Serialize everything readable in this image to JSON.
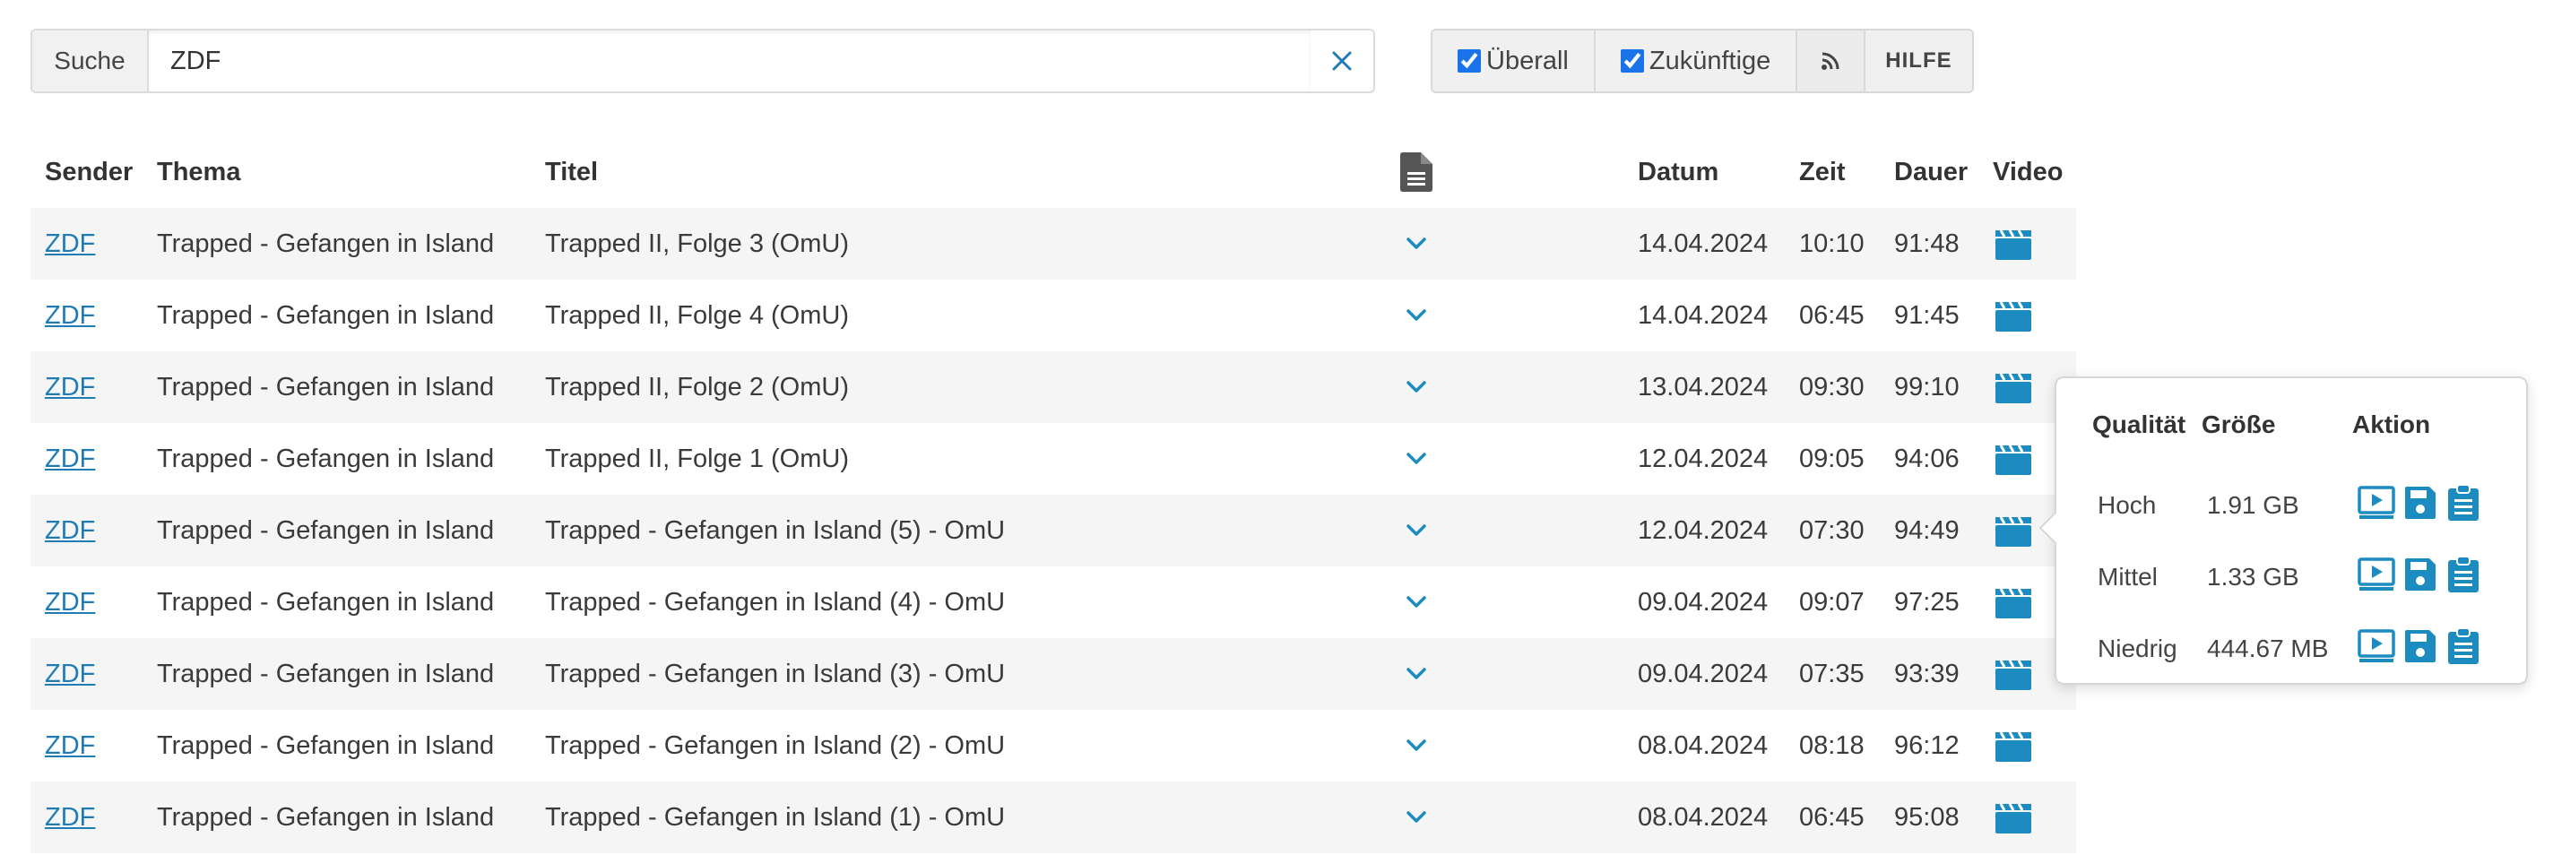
{
  "search": {
    "label": "Suche",
    "value": "ZDF"
  },
  "toolbar": {
    "everywhere_label": "Überall",
    "everywhere_checked": true,
    "future_label": "Zukünftige",
    "future_checked": true,
    "help_label": "HILFE"
  },
  "table": {
    "headers": {
      "sender": "Sender",
      "thema": "Thema",
      "titel": "Titel",
      "datum": "Datum",
      "zeit": "Zeit",
      "dauer": "Dauer",
      "video": "Video"
    },
    "rows": [
      {
        "sender": "ZDF",
        "thema": "Trapped - Gefangen in Island",
        "titel": "Trapped II, Folge 3 (OmU)",
        "datum": "14.04.2024",
        "zeit": "10:10",
        "dauer": "91:48"
      },
      {
        "sender": "ZDF",
        "thema": "Trapped - Gefangen in Island",
        "titel": "Trapped II, Folge 4 (OmU)",
        "datum": "14.04.2024",
        "zeit": "06:45",
        "dauer": "91:45"
      },
      {
        "sender": "ZDF",
        "thema": "Trapped - Gefangen in Island",
        "titel": "Trapped II, Folge 2 (OmU)",
        "datum": "13.04.2024",
        "zeit": "09:30",
        "dauer": "99:10"
      },
      {
        "sender": "ZDF",
        "thema": "Trapped - Gefangen in Island",
        "titel": "Trapped II, Folge 1 (OmU)",
        "datum": "12.04.2024",
        "zeit": "09:05",
        "dauer": "94:06"
      },
      {
        "sender": "ZDF",
        "thema": "Trapped - Gefangen in Island",
        "titel": "Trapped - Gefangen in Island (5) - OmU",
        "datum": "12.04.2024",
        "zeit": "07:30",
        "dauer": "94:49"
      },
      {
        "sender": "ZDF",
        "thema": "Trapped - Gefangen in Island",
        "titel": "Trapped - Gefangen in Island (4) - OmU",
        "datum": "09.04.2024",
        "zeit": "09:07",
        "dauer": "97:25"
      },
      {
        "sender": "ZDF",
        "thema": "Trapped - Gefangen in Island",
        "titel": "Trapped - Gefangen in Island (3) - OmU",
        "datum": "09.04.2024",
        "zeit": "07:35",
        "dauer": "93:39"
      },
      {
        "sender": "ZDF",
        "thema": "Trapped - Gefangen in Island",
        "titel": "Trapped - Gefangen in Island (2) - OmU",
        "datum": "08.04.2024",
        "zeit": "08:18",
        "dauer": "96:12"
      },
      {
        "sender": "ZDF",
        "thema": "Trapped - Gefangen in Island",
        "titel": "Trapped - Gefangen in Island (1) - OmU",
        "datum": "08.04.2024",
        "zeit": "06:45",
        "dauer": "95:08"
      }
    ]
  },
  "popover": {
    "headers": {
      "quality": "Qualität",
      "size": "Größe",
      "action": "Aktion"
    },
    "rows": [
      {
        "quality": "Hoch",
        "size": "1.91 GB"
      },
      {
        "quality": "Mittel",
        "size": "1.33 GB"
      },
      {
        "quality": "Niedrig",
        "size": "444.67 MB"
      }
    ]
  },
  "icons": {
    "clear": "close-icon",
    "rss": "rss-icon",
    "description": "document-icon",
    "expand": "chevron-down-icon",
    "video": "clapperboard-icon",
    "play": "play-icon",
    "download": "floppy-disk-icon",
    "copy": "clipboard-icon"
  },
  "colors": {
    "accent": "#1f7bb5",
    "row_stripe": "#f5f5f5",
    "icon_blue": "#1c8bc0"
  }
}
